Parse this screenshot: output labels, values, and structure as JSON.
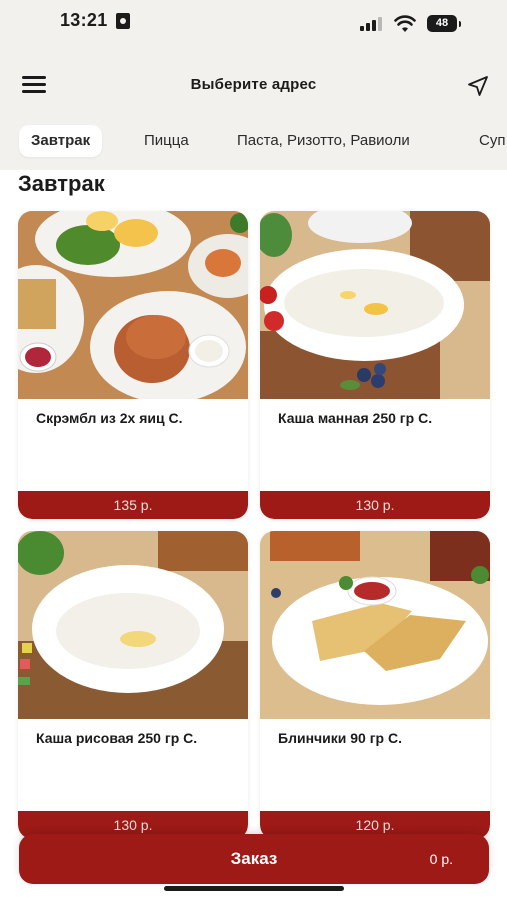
{
  "status": {
    "time": "13:21",
    "battery": "48"
  },
  "header": {
    "title": "Выберите адрес",
    "menu_icon": "hamburger-menu-icon",
    "location_icon": "navigation-arrow-icon"
  },
  "tabs": [
    {
      "label": "Завтрак",
      "active": true
    },
    {
      "label": "Пицца"
    },
    {
      "label": "Паста, Ризотто, Равиоли"
    },
    {
      "label": "Суп"
    }
  ],
  "section": {
    "title": "Завтрак"
  },
  "products": [
    {
      "name": "Скрэмбл из 2х яиц С.",
      "price": "135 р."
    },
    {
      "name": "Каша манная 250 гр С.",
      "price": "130 р."
    },
    {
      "name": "Каша рисовая 250 гр С.",
      "price": "130 р."
    },
    {
      "name": "Блинчики 90 гр С.",
      "price": "120 р."
    }
  ],
  "order": {
    "label": "Заказ",
    "total": "0 р."
  },
  "colors": {
    "brand": "#9e1a16",
    "header_bg": "#f2f1ee"
  }
}
